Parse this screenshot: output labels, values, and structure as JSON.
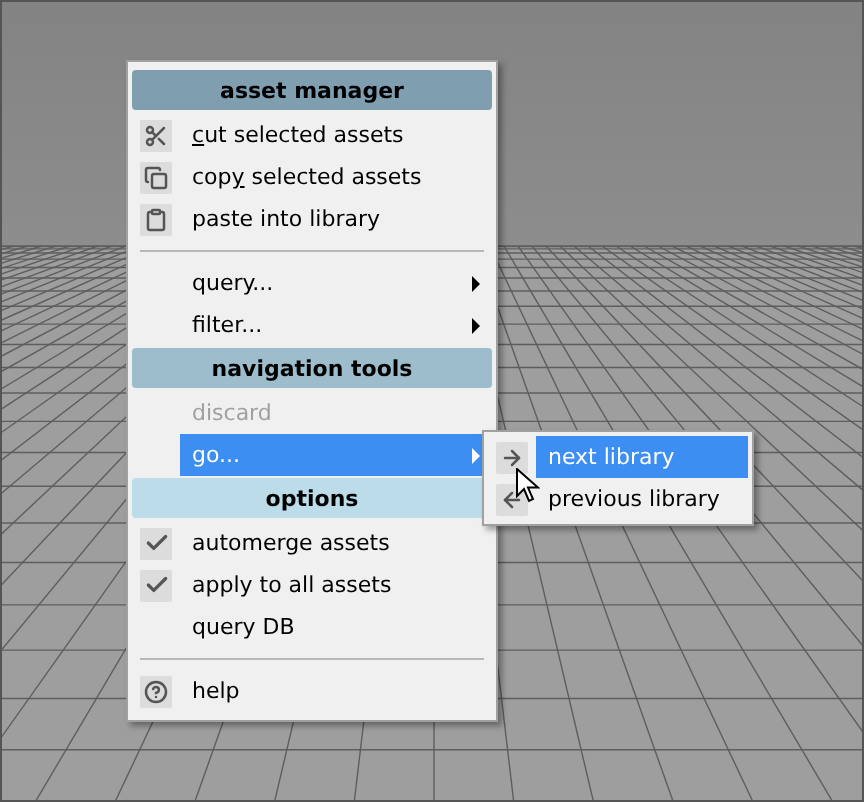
{
  "menu": {
    "sections": [
      {
        "title": "asset manager",
        "color": "#7f9eb0",
        "items": [
          {
            "kind": "action",
            "label": "cut selected assets"
          },
          {
            "kind": "action",
            "label": "copy selected assets"
          },
          {
            "kind": "action",
            "label": "paste into library"
          },
          {
            "kind": "divider"
          },
          {
            "kind": "submenu",
            "label": "query...",
            "selected": false
          },
          {
            "kind": "submenu",
            "label": "filter...",
            "selected": false
          }
        ]
      },
      {
        "title": "navigation tools",
        "color": "#9dbdcd",
        "items": [
          {
            "kind": "action",
            "label": "discard",
            "disabled": true
          },
          {
            "kind": "submenu",
            "label": "go...",
            "selected": true
          }
        ]
      },
      {
        "title": "options",
        "color": "#bcdcea",
        "items": [
          {
            "kind": "check",
            "label": "automerge assets",
            "checked": true
          },
          {
            "kind": "check",
            "label": "apply to all assets",
            "checked": true
          },
          {
            "kind": "action",
            "label": "query DB"
          },
          {
            "kind": "divider"
          },
          {
            "kind": "action",
            "label": "help"
          }
        ]
      }
    ]
  },
  "submenu": {
    "items": [
      {
        "label": "next library",
        "selected": true
      },
      {
        "label": "previous library",
        "selected": false
      }
    ]
  }
}
